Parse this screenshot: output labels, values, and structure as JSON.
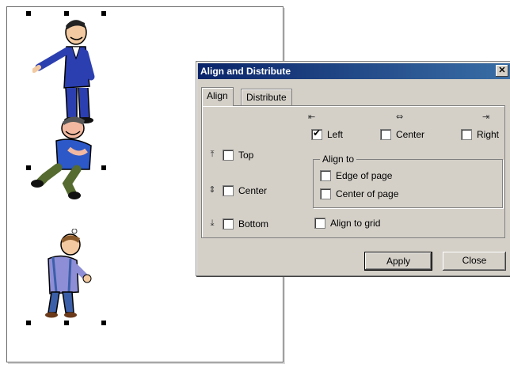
{
  "dialog": {
    "title": "Align and Distribute",
    "close_glyph": "✕",
    "tabs": [
      {
        "label": "Align",
        "active": true
      },
      {
        "label": "Distribute",
        "active": false
      }
    ],
    "horizontal": {
      "left": {
        "label": "Left",
        "checked": true
      },
      "center": {
        "label": "Center",
        "checked": false
      },
      "right": {
        "label": "Right",
        "checked": false
      }
    },
    "vertical": {
      "top": {
        "label": "Top",
        "checked": false
      },
      "center": {
        "label": "Center",
        "checked": false
      },
      "bottom": {
        "label": "Bottom",
        "checked": false
      }
    },
    "align_to": {
      "title": "Align to",
      "edge_of_page": {
        "label": "Edge of page",
        "checked": false
      },
      "center_of_page": {
        "label": "Center of page",
        "checked": false
      }
    },
    "align_to_grid": {
      "label": "Align to grid",
      "checked": false
    },
    "buttons": {
      "apply": "Apply",
      "close": "Close"
    }
  },
  "icons": {
    "align_left": "align-left-icon",
    "align_center_h": "align-center-horizontal-icon",
    "align_right": "align-right-icon",
    "align_top": "align-top-icon",
    "align_center_v": "align-center-vertical-icon",
    "align_bottom": "align-bottom-icon"
  },
  "colors": {
    "title_bar_start": "#0a246a",
    "title_bar_end": "#3a6ea5",
    "dialog_face": "#d4d0c8"
  }
}
